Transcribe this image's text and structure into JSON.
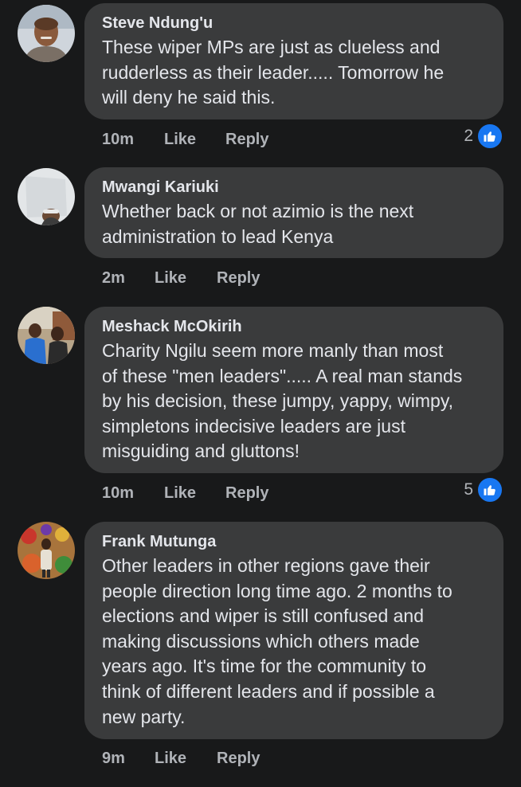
{
  "comments": [
    {
      "author": "Steve Ndung'u",
      "lines": [
        "These wiper MPs are just as clueless and",
        "rudderless as their leader..... Tomorrow he",
        "will deny he said this."
      ],
      "time": "10m",
      "like_label": "Like",
      "reply_label": "Reply",
      "reaction_count": "2"
    },
    {
      "author": "Mwangi Kariuki",
      "lines": [
        "Whether back or not azimio is the next",
        "administration to lead Kenya"
      ],
      "time": "2m",
      "like_label": "Like",
      "reply_label": "Reply"
    },
    {
      "author": "Meshack McOkirih",
      "lines": [
        "Charity Ngilu seem more manly than most",
        "of these \"men leaders\"..... A real man stands",
        "by his decision, these jumpy, yappy, wimpy,",
        "simpletons indecisive leaders are just",
        "misguiding and gluttons!"
      ],
      "time": "10m",
      "like_label": "Like",
      "reply_label": "Reply",
      "reaction_count": "5"
    },
    {
      "author": "Frank Mutunga",
      "lines": [
        "Other leaders in other regions gave their",
        "people direction long time ago. 2 months to",
        "elections and wiper is still confused and",
        "making discussions which others made",
        "years ago. It's time for the community to",
        "think of different leaders and if possible a",
        "new party."
      ],
      "time": "9m",
      "like_label": "Like",
      "reply_label": "Reply"
    }
  ],
  "colors": {
    "background": "#18191a",
    "bubble": "#3a3b3c",
    "text": "#e4e6eb",
    "meta": "#b0b3b8",
    "like_badge": "#1877f2"
  },
  "icons": {
    "reaction": "thumbs-up-icon"
  }
}
